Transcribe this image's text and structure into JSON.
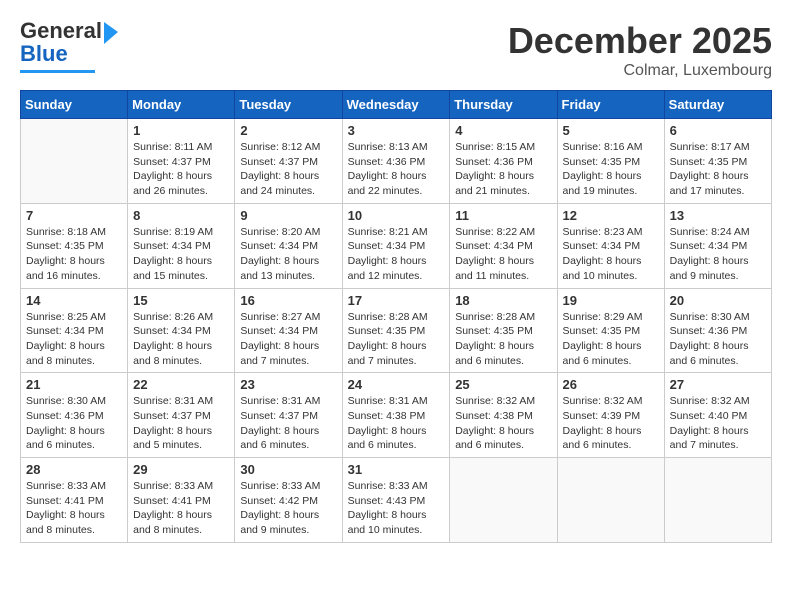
{
  "logo": {
    "line1": "General",
    "line2": "Blue"
  },
  "header": {
    "month": "December 2025",
    "location": "Colmar, Luxembourg"
  },
  "weekdays": [
    "Sunday",
    "Monday",
    "Tuesday",
    "Wednesday",
    "Thursday",
    "Friday",
    "Saturday"
  ],
  "weeks": [
    [
      {
        "day": null,
        "info": null
      },
      {
        "day": "1",
        "sunrise": "8:11 AM",
        "sunset": "4:37 PM",
        "daylight": "8 hours and 26 minutes."
      },
      {
        "day": "2",
        "sunrise": "8:12 AM",
        "sunset": "4:37 PM",
        "daylight": "8 hours and 24 minutes."
      },
      {
        "day": "3",
        "sunrise": "8:13 AM",
        "sunset": "4:36 PM",
        "daylight": "8 hours and 22 minutes."
      },
      {
        "day": "4",
        "sunrise": "8:15 AM",
        "sunset": "4:36 PM",
        "daylight": "8 hours and 21 minutes."
      },
      {
        "day": "5",
        "sunrise": "8:16 AM",
        "sunset": "4:35 PM",
        "daylight": "8 hours and 19 minutes."
      },
      {
        "day": "6",
        "sunrise": "8:17 AM",
        "sunset": "4:35 PM",
        "daylight": "8 hours and 17 minutes."
      }
    ],
    [
      {
        "day": "7",
        "sunrise": "8:18 AM",
        "sunset": "4:35 PM",
        "daylight": "8 hours and 16 minutes."
      },
      {
        "day": "8",
        "sunrise": "8:19 AM",
        "sunset": "4:34 PM",
        "daylight": "8 hours and 15 minutes."
      },
      {
        "day": "9",
        "sunrise": "8:20 AM",
        "sunset": "4:34 PM",
        "daylight": "8 hours and 13 minutes."
      },
      {
        "day": "10",
        "sunrise": "8:21 AM",
        "sunset": "4:34 PM",
        "daylight": "8 hours and 12 minutes."
      },
      {
        "day": "11",
        "sunrise": "8:22 AM",
        "sunset": "4:34 PM",
        "daylight": "8 hours and 11 minutes."
      },
      {
        "day": "12",
        "sunrise": "8:23 AM",
        "sunset": "4:34 PM",
        "daylight": "8 hours and 10 minutes."
      },
      {
        "day": "13",
        "sunrise": "8:24 AM",
        "sunset": "4:34 PM",
        "daylight": "8 hours and 9 minutes."
      }
    ],
    [
      {
        "day": "14",
        "sunrise": "8:25 AM",
        "sunset": "4:34 PM",
        "daylight": "8 hours and 8 minutes."
      },
      {
        "day": "15",
        "sunrise": "8:26 AM",
        "sunset": "4:34 PM",
        "daylight": "8 hours and 8 minutes."
      },
      {
        "day": "16",
        "sunrise": "8:27 AM",
        "sunset": "4:34 PM",
        "daylight": "8 hours and 7 minutes."
      },
      {
        "day": "17",
        "sunrise": "8:28 AM",
        "sunset": "4:35 PM",
        "daylight": "8 hours and 7 minutes."
      },
      {
        "day": "18",
        "sunrise": "8:28 AM",
        "sunset": "4:35 PM",
        "daylight": "8 hours and 6 minutes."
      },
      {
        "day": "19",
        "sunrise": "8:29 AM",
        "sunset": "4:35 PM",
        "daylight": "8 hours and 6 minutes."
      },
      {
        "day": "20",
        "sunrise": "8:30 AM",
        "sunset": "4:36 PM",
        "daylight": "8 hours and 6 minutes."
      }
    ],
    [
      {
        "day": "21",
        "sunrise": "8:30 AM",
        "sunset": "4:36 PM",
        "daylight": "8 hours and 6 minutes."
      },
      {
        "day": "22",
        "sunrise": "8:31 AM",
        "sunset": "4:37 PM",
        "daylight": "8 hours and 5 minutes."
      },
      {
        "day": "23",
        "sunrise": "8:31 AM",
        "sunset": "4:37 PM",
        "daylight": "8 hours and 6 minutes."
      },
      {
        "day": "24",
        "sunrise": "8:31 AM",
        "sunset": "4:38 PM",
        "daylight": "8 hours and 6 minutes."
      },
      {
        "day": "25",
        "sunrise": "8:32 AM",
        "sunset": "4:38 PM",
        "daylight": "8 hours and 6 minutes."
      },
      {
        "day": "26",
        "sunrise": "8:32 AM",
        "sunset": "4:39 PM",
        "daylight": "8 hours and 6 minutes."
      },
      {
        "day": "27",
        "sunrise": "8:32 AM",
        "sunset": "4:40 PM",
        "daylight": "8 hours and 7 minutes."
      }
    ],
    [
      {
        "day": "28",
        "sunrise": "8:33 AM",
        "sunset": "4:41 PM",
        "daylight": "8 hours and 8 minutes."
      },
      {
        "day": "29",
        "sunrise": "8:33 AM",
        "sunset": "4:41 PM",
        "daylight": "8 hours and 8 minutes."
      },
      {
        "day": "30",
        "sunrise": "8:33 AM",
        "sunset": "4:42 PM",
        "daylight": "8 hours and 9 minutes."
      },
      {
        "day": "31",
        "sunrise": "8:33 AM",
        "sunset": "4:43 PM",
        "daylight": "8 hours and 10 minutes."
      },
      {
        "day": null,
        "info": null
      },
      {
        "day": null,
        "info": null
      },
      {
        "day": null,
        "info": null
      }
    ]
  ],
  "labels": {
    "sunrise": "Sunrise:",
    "sunset": "Sunset:",
    "daylight": "Daylight:"
  }
}
